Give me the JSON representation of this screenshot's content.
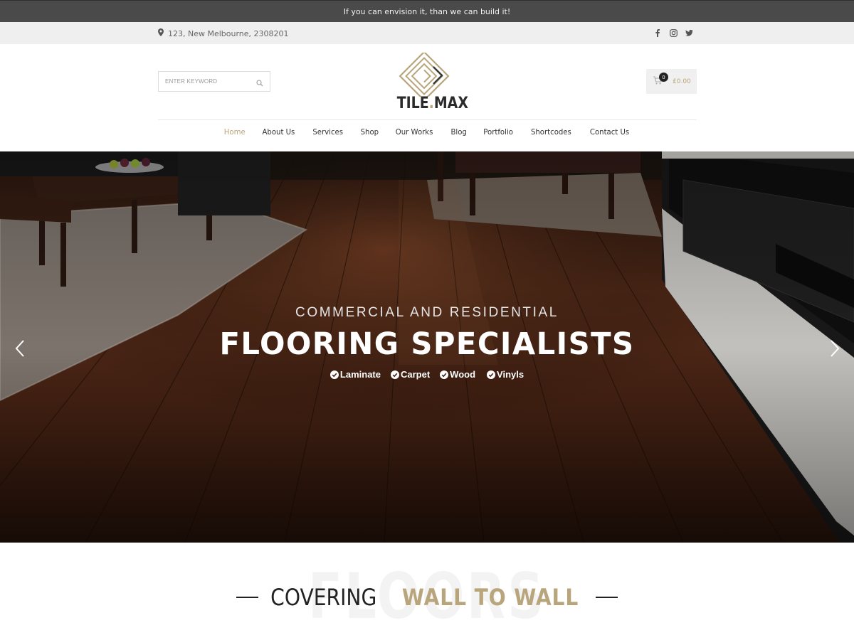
{
  "announcement": {
    "text": "If you can envision it, than we can build it!"
  },
  "infobar": {
    "address": "123, New Melbourne, 2308201",
    "address_icon": "map-marker-icon",
    "social": [
      "facebook-icon",
      "instagram-icon",
      "twitter-icon"
    ]
  },
  "header": {
    "search": {
      "placeholder": "ENTER KEYWORD",
      "icon": "search-icon"
    },
    "logo": {
      "part1": "TILE",
      "dot": ".",
      "part2": "MAX"
    },
    "cart": {
      "count": "0",
      "amount": "£0.00",
      "icon": "cart-icon"
    }
  },
  "nav": {
    "items": [
      {
        "label": "Home",
        "active": true
      },
      {
        "label": "About Us"
      },
      {
        "label": "Services"
      },
      {
        "label": "Shop"
      },
      {
        "label": "Our Works"
      },
      {
        "label": "Blog"
      },
      {
        "label": "Portfolio"
      },
      {
        "label": "Shortcodes"
      },
      {
        "label": "Contact Us"
      }
    ]
  },
  "hero": {
    "eyebrow": "COMMERCIAL AND RESIDENTIAL",
    "headline": "FLOORING SPECIALISTS",
    "features": [
      "Laminate",
      "Carpet",
      "Wood",
      "Vinyls"
    ],
    "prev_icon": "chevron-left-icon",
    "next_icon": "chevron-right-icon"
  },
  "section": {
    "ghost": "FLOORS",
    "light": "COVERING",
    "bold": "WALL TO WALL"
  },
  "colors": {
    "accent": "#b9a57c",
    "announce_bg": "#4a4a4a",
    "infobar_bg": "#efefef",
    "dark_text": "#222222"
  }
}
